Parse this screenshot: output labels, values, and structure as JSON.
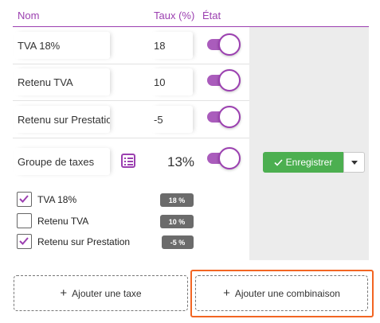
{
  "headers": {
    "name": "Nom",
    "rate": "Taux (%)",
    "state": "État"
  },
  "rows": [
    {
      "name": "TVA 18%",
      "rate": "18",
      "enabled": true
    },
    {
      "name": "Retenu TVA",
      "rate": "10",
      "enabled": true
    },
    {
      "name": "Retenu sur Prestation",
      "rate": "-5",
      "enabled": true
    }
  ],
  "group": {
    "name": "Groupe de taxes",
    "rate": "13%",
    "enabled": true,
    "save_label": "Enregistrer",
    "members": [
      {
        "label": "TVA 18%",
        "checked": true,
        "badge": "18 %"
      },
      {
        "label": "Retenu TVA",
        "checked": false,
        "badge": "10 %"
      },
      {
        "label": "Retenu sur Prestation",
        "checked": true,
        "badge": "-5 %"
      }
    ]
  },
  "actions": {
    "add_tax": "Ajouter une taxe",
    "add_combination": "Ajouter une combinaison"
  },
  "colors": {
    "accent": "#9b3fb0",
    "save": "#4caf50",
    "highlight": "#f26522",
    "badge": "#6b6b6b"
  },
  "icons": [
    "list-icon",
    "check-icon",
    "caret-down-icon",
    "plus-icon",
    "checkmark-icon"
  ]
}
